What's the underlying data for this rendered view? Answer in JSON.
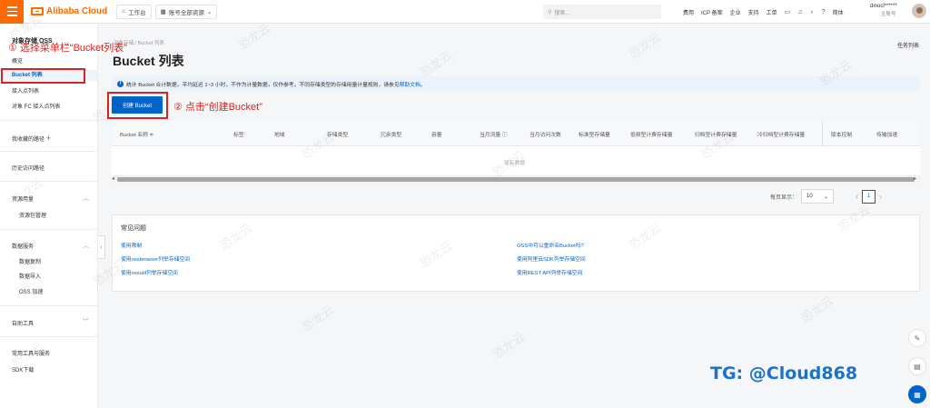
{
  "topbar": {
    "brand": "Alibaba Cloud",
    "workbench": "工作台",
    "resource_scope": "账号全部资源",
    "search_placeholder": "搜索...",
    "links": [
      "费用",
      "ICP 备案",
      "企业",
      "支持",
      "工单"
    ],
    "lang": "简体",
    "user_name": "dinocl******",
    "user_role": "主账号"
  },
  "sidebar": {
    "title": "对象存储 OSS",
    "items": {
      "overview": "概览",
      "bucket_list": "Bucket 列表",
      "access_points": "接入点列表",
      "fc_access_points": "对象 FC 接入点列表",
      "favorites": "我收藏的路径",
      "favorites_add": "+",
      "history": "历史访问路径",
      "resource_usage": "资源用量",
      "resource_pkg": "资源包管理",
      "data_service": "数据服务",
      "data_replication": "数据复制",
      "data_import": "数据导入",
      "oss_accel": "OSS 加速",
      "self_tools": "自助工具",
      "common_tools": "常用工具与服务",
      "sdk_download": "SDK下载"
    },
    "collapse_icon": "‹"
  },
  "main": {
    "breadcrumb": "对象存储 / Bucket 列表",
    "title": "Bucket 列表",
    "task_list": "任务列表",
    "notice_icon": "i",
    "notice_text": "统计 Bucket 合计数据，平均延迟 1~3 小时，不作为计量数据，仅作参考。不同存储类型的存储用量计量规则，请参见",
    "notice_link": "帮助文档",
    "notice_end": "。",
    "create_button": "创建 Bucket",
    "columns": {
      "name": "Bucket 名称 ≑",
      "tag": "标签",
      "region": "地域",
      "storage_class": "存储类型",
      "redundancy": "冗余类型",
      "capacity": "容量",
      "traffic": "当月流量 ⓘ",
      "requests": "当月访问次数",
      "std_usage": "标准型存储量",
      "ia_usage": "低频型计费存储量",
      "archive_usage": "归档型计费存储量",
      "cold_usage": "冷归档型计费存储量",
      "versioning": "版本控制",
      "accel": "传输加速"
    },
    "empty_text": "没有数据",
    "pager": {
      "label": "每页显示：",
      "size": "10",
      "page": "1",
      "prev": "‹",
      "next": "›"
    },
    "faq": {
      "title": "常见问题",
      "links": [
        "使用限制",
        "使用ossbrowser列举存储空间",
        "使用ossutil列举存储空间",
        "OSS中可以重命名Bucket吗?",
        "使用阿里云SDK列举存储空间",
        "使用REST API列举存储空间"
      ]
    }
  },
  "annotations": {
    "step1": "① 选择菜单栏“Bucket列表”",
    "step2": "② 点击“创建Bucket”",
    "tg": "TG: @Cloud868"
  },
  "watermark": "恐龙云",
  "colors": {
    "brand": "#ff6a00",
    "primary": "#0064c8",
    "annotation": "#e02020"
  }
}
